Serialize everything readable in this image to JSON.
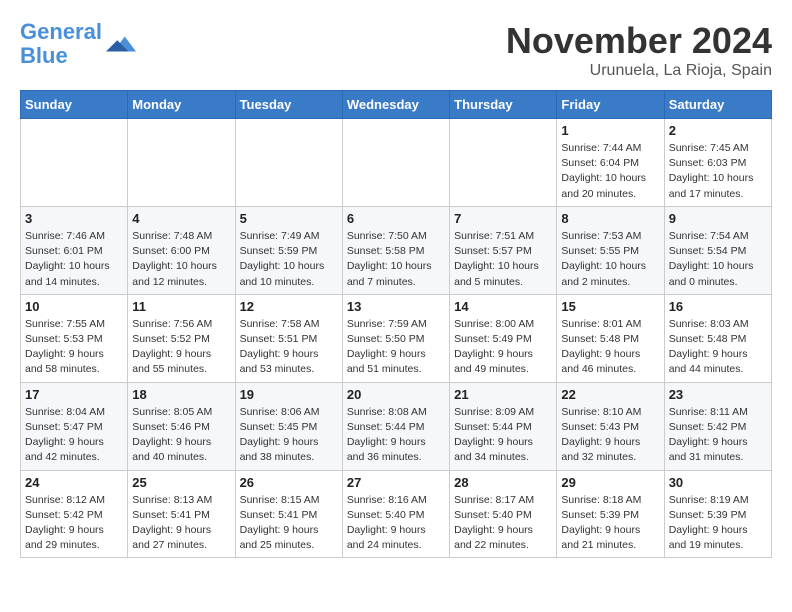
{
  "logo": {
    "line1": "General",
    "line2": "Blue"
  },
  "title": "November 2024",
  "location": "Urunuela, La Rioja, Spain",
  "days_of_week": [
    "Sunday",
    "Monday",
    "Tuesday",
    "Wednesday",
    "Thursday",
    "Friday",
    "Saturday"
  ],
  "weeks": [
    [
      {
        "day": "",
        "info": ""
      },
      {
        "day": "",
        "info": ""
      },
      {
        "day": "",
        "info": ""
      },
      {
        "day": "",
        "info": ""
      },
      {
        "day": "",
        "info": ""
      },
      {
        "day": "1",
        "info": "Sunrise: 7:44 AM\nSunset: 6:04 PM\nDaylight: 10 hours and 20 minutes."
      },
      {
        "day": "2",
        "info": "Sunrise: 7:45 AM\nSunset: 6:03 PM\nDaylight: 10 hours and 17 minutes."
      }
    ],
    [
      {
        "day": "3",
        "info": "Sunrise: 7:46 AM\nSunset: 6:01 PM\nDaylight: 10 hours and 14 minutes."
      },
      {
        "day": "4",
        "info": "Sunrise: 7:48 AM\nSunset: 6:00 PM\nDaylight: 10 hours and 12 minutes."
      },
      {
        "day": "5",
        "info": "Sunrise: 7:49 AM\nSunset: 5:59 PM\nDaylight: 10 hours and 10 minutes."
      },
      {
        "day": "6",
        "info": "Sunrise: 7:50 AM\nSunset: 5:58 PM\nDaylight: 10 hours and 7 minutes."
      },
      {
        "day": "7",
        "info": "Sunrise: 7:51 AM\nSunset: 5:57 PM\nDaylight: 10 hours and 5 minutes."
      },
      {
        "day": "8",
        "info": "Sunrise: 7:53 AM\nSunset: 5:55 PM\nDaylight: 10 hours and 2 minutes."
      },
      {
        "day": "9",
        "info": "Sunrise: 7:54 AM\nSunset: 5:54 PM\nDaylight: 10 hours and 0 minutes."
      }
    ],
    [
      {
        "day": "10",
        "info": "Sunrise: 7:55 AM\nSunset: 5:53 PM\nDaylight: 9 hours and 58 minutes."
      },
      {
        "day": "11",
        "info": "Sunrise: 7:56 AM\nSunset: 5:52 PM\nDaylight: 9 hours and 55 minutes."
      },
      {
        "day": "12",
        "info": "Sunrise: 7:58 AM\nSunset: 5:51 PM\nDaylight: 9 hours and 53 minutes."
      },
      {
        "day": "13",
        "info": "Sunrise: 7:59 AM\nSunset: 5:50 PM\nDaylight: 9 hours and 51 minutes."
      },
      {
        "day": "14",
        "info": "Sunrise: 8:00 AM\nSunset: 5:49 PM\nDaylight: 9 hours and 49 minutes."
      },
      {
        "day": "15",
        "info": "Sunrise: 8:01 AM\nSunset: 5:48 PM\nDaylight: 9 hours and 46 minutes."
      },
      {
        "day": "16",
        "info": "Sunrise: 8:03 AM\nSunset: 5:48 PM\nDaylight: 9 hours and 44 minutes."
      }
    ],
    [
      {
        "day": "17",
        "info": "Sunrise: 8:04 AM\nSunset: 5:47 PM\nDaylight: 9 hours and 42 minutes."
      },
      {
        "day": "18",
        "info": "Sunrise: 8:05 AM\nSunset: 5:46 PM\nDaylight: 9 hours and 40 minutes."
      },
      {
        "day": "19",
        "info": "Sunrise: 8:06 AM\nSunset: 5:45 PM\nDaylight: 9 hours and 38 minutes."
      },
      {
        "day": "20",
        "info": "Sunrise: 8:08 AM\nSunset: 5:44 PM\nDaylight: 9 hours and 36 minutes."
      },
      {
        "day": "21",
        "info": "Sunrise: 8:09 AM\nSunset: 5:44 PM\nDaylight: 9 hours and 34 minutes."
      },
      {
        "day": "22",
        "info": "Sunrise: 8:10 AM\nSunset: 5:43 PM\nDaylight: 9 hours and 32 minutes."
      },
      {
        "day": "23",
        "info": "Sunrise: 8:11 AM\nSunset: 5:42 PM\nDaylight: 9 hours and 31 minutes."
      }
    ],
    [
      {
        "day": "24",
        "info": "Sunrise: 8:12 AM\nSunset: 5:42 PM\nDaylight: 9 hours and 29 minutes."
      },
      {
        "day": "25",
        "info": "Sunrise: 8:13 AM\nSunset: 5:41 PM\nDaylight: 9 hours and 27 minutes."
      },
      {
        "day": "26",
        "info": "Sunrise: 8:15 AM\nSunset: 5:41 PM\nDaylight: 9 hours and 25 minutes."
      },
      {
        "day": "27",
        "info": "Sunrise: 8:16 AM\nSunset: 5:40 PM\nDaylight: 9 hours and 24 minutes."
      },
      {
        "day": "28",
        "info": "Sunrise: 8:17 AM\nSunset: 5:40 PM\nDaylight: 9 hours and 22 minutes."
      },
      {
        "day": "29",
        "info": "Sunrise: 8:18 AM\nSunset: 5:39 PM\nDaylight: 9 hours and 21 minutes."
      },
      {
        "day": "30",
        "info": "Sunrise: 8:19 AM\nSunset: 5:39 PM\nDaylight: 9 hours and 19 minutes."
      }
    ]
  ]
}
